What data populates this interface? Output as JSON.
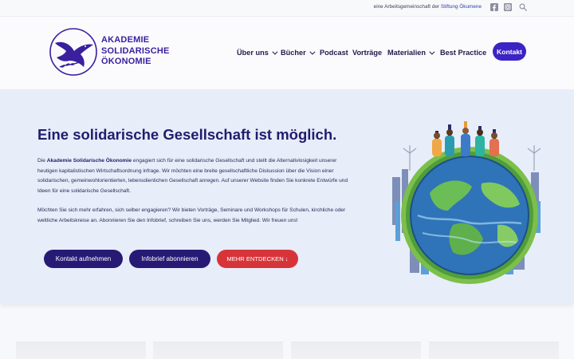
{
  "topbar": {
    "text_prefix": "eine Arbeitsgemeinschaft der",
    "text_link": "Stiftung Ökumene",
    "icons": [
      "facebook-icon",
      "instagram-icon",
      "search-icon"
    ]
  },
  "logo": {
    "line1": "AKADEMIE",
    "line2": "SOLIDARISCHE",
    "line3": "ÖKONOMIE"
  },
  "nav": {
    "items": [
      {
        "label": "Über uns",
        "has_dropdown": true
      },
      {
        "label": "Bücher",
        "has_dropdown": true
      },
      {
        "label": "Podcast",
        "has_dropdown": false
      },
      {
        "label": "Vorträge",
        "has_dropdown": false
      },
      {
        "label": "Materialien",
        "has_dropdown": true
      },
      {
        "label": "Best Practice",
        "has_dropdown": false
      }
    ],
    "contact_label": "Kontakt"
  },
  "hero": {
    "title": "Eine solidarische Gesellschaft ist möglich.",
    "para1_pre": "Die",
    "para1_bold": "Akademie Solidarische Ökonomie",
    "para1_post": "engagiert sich für eine solidarische Gesellschaft und stellt die Alternativlosigkeit unserer heutigen kapitalistischen Wirtschaftsordnung infrage. Wir möchten eine breite gesellschaftliche Diskussion über die Vision einer solidarischen, gemeinwohlorientierten, lebensdienlichen Gesellschaft anregen. Auf unserer Website finden Sie konkrete Entwürfe und Ideen für eine solidarische Gesellschaft.",
    "para2": "Möchten Sie sich mehr erfahren, sich selber engagieren? Wir bieten Vorträge, Seminare und Workshops für Schulen, kirchliche oder weltliche Arbeitskreise an. Abonnieren Sie den Infobrief, schreiben Sie uns, werden Sie Mitglied. Wir freuen uns!",
    "buttons": {
      "contact": "Kontakt aufnehmen",
      "newsletter": "Infobrief abonnieren",
      "discover": "MEHR ENTDECKEN ↓"
    }
  },
  "colors": {
    "brand_purple": "#3a24c4",
    "dark_navy": "#271a75",
    "accent_red": "#d7343a",
    "hero_bg": "#e7edf9"
  }
}
